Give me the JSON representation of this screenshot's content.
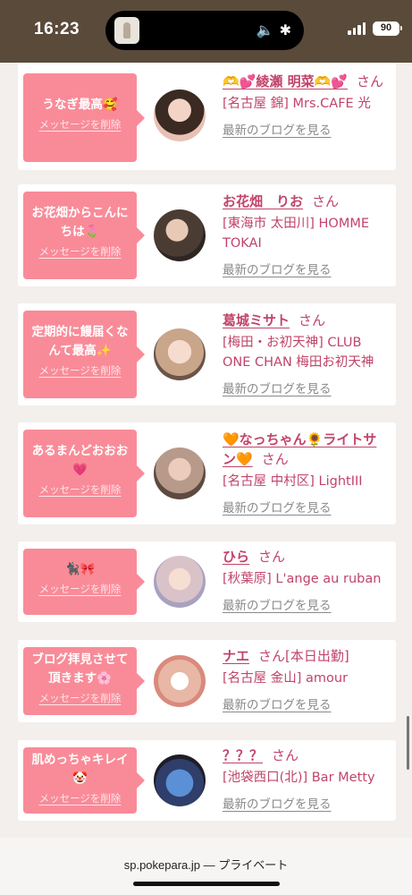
{
  "status": {
    "time": "16:23",
    "battery": "90",
    "icons": [
      "mute-icon",
      "bluetooth-icon",
      "signal-icon",
      "battery-icon"
    ]
  },
  "colors": {
    "accent": "#c1446a",
    "bubble": "#f98b98",
    "header": "#5a4a3a",
    "link": "#8a8a8a"
  },
  "actions": {
    "delete_label": "メッセージを削除",
    "blog_label": "最新のブログを見る"
  },
  "items": [
    {
      "message": "うなぎ最高🥰",
      "name": "🫶💕綾瀬 明菜🫶💕",
      "suffix": "さん",
      "shop": "[名古屋 錦] Mrs.CAFE 光"
    },
    {
      "message": "お花畑からこんにちは🌷",
      "name": "お花畑　りお",
      "suffix": "さん",
      "shop": "[東海市 太田川] HOMME TOKAI"
    },
    {
      "message": "定期的に饅届くなんて最高✨",
      "name": "葛城ミサト",
      "suffix": "さん",
      "shop": "[梅田・お初天神] CLUB ONE CHAN 梅田お初天神"
    },
    {
      "message": "あるまんどおおお💗",
      "name": "🧡なっちゃん🌻ライトサン🧡",
      "suffix": "さん",
      "shop": "[名古屋 中村区] LightIII"
    },
    {
      "message": "🐈‍⬛🎀",
      "name": "ひら",
      "suffix": "さん",
      "shop": "[秋葉原] L'ange au ruban"
    },
    {
      "message": "ブログ拝見させて頂きます🌸",
      "name": "ナエ",
      "suffix": "さん[本日出勤]",
      "shop": "[名古屋 金山] amour"
    },
    {
      "message": "肌めっちゃキレイ🤡",
      "name": "？？？",
      "suffix": "さん",
      "shop": "[池袋西口(北)] Bar Metty"
    }
  ],
  "browser": {
    "url": "sp.pokepara.jp — プライベート"
  }
}
